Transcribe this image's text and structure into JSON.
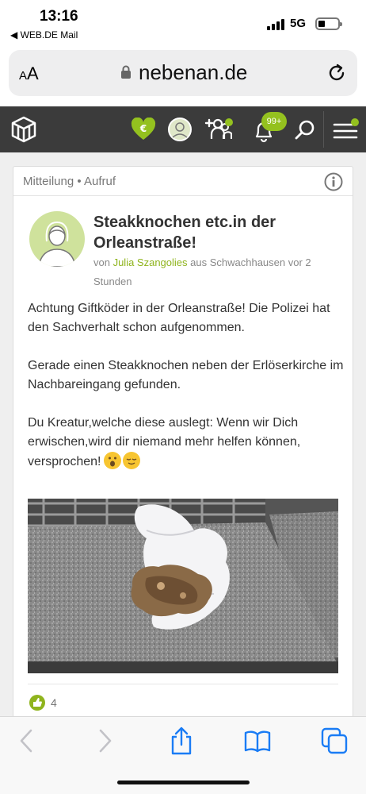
{
  "status_bar": {
    "time": "13:16",
    "back_app": "◀ WEB.DE Mail",
    "network": "5G"
  },
  "address_bar": {
    "text_size_label": "AA",
    "url": "nebenan.de"
  },
  "site_header": {
    "notification_count": "99+",
    "accent_color": "#94c11f",
    "icons": [
      "logo-icon",
      "euro-heart-icon",
      "profile-avatar-icon",
      "add-neighbor-icon",
      "bell-icon",
      "search-icon",
      "menu-icon"
    ]
  },
  "post": {
    "category": "Mitteilung",
    "category_sep": " • ",
    "category_type": "Aufruf",
    "title": "Steakknochen etc.in der Orleanstraße!",
    "byline_prefix": "von ",
    "author": "Julia Szangolies",
    "byline_suffix": " aus Schwachhausen vor 2 Stunden",
    "paragraphs": [
      "Achtung Giftköder in der Orleanstraße! Die Polizei hat den Sachverhalt schon aufgenommen.",
      "Gerade einen Steakknochen neben der Erlöserkirche im Nachbareingang gefunden.",
      "Du Kreatur,welche diese auslegt: Wenn wir Dich erwischen,wird dir niemand mehr helfen können, versprochen!"
    ],
    "like_count": "4"
  },
  "toolbar": {
    "icons": [
      "back-arrow-icon",
      "forward-arrow-icon",
      "share-icon",
      "bookmarks-icon",
      "tabs-icon"
    ]
  }
}
